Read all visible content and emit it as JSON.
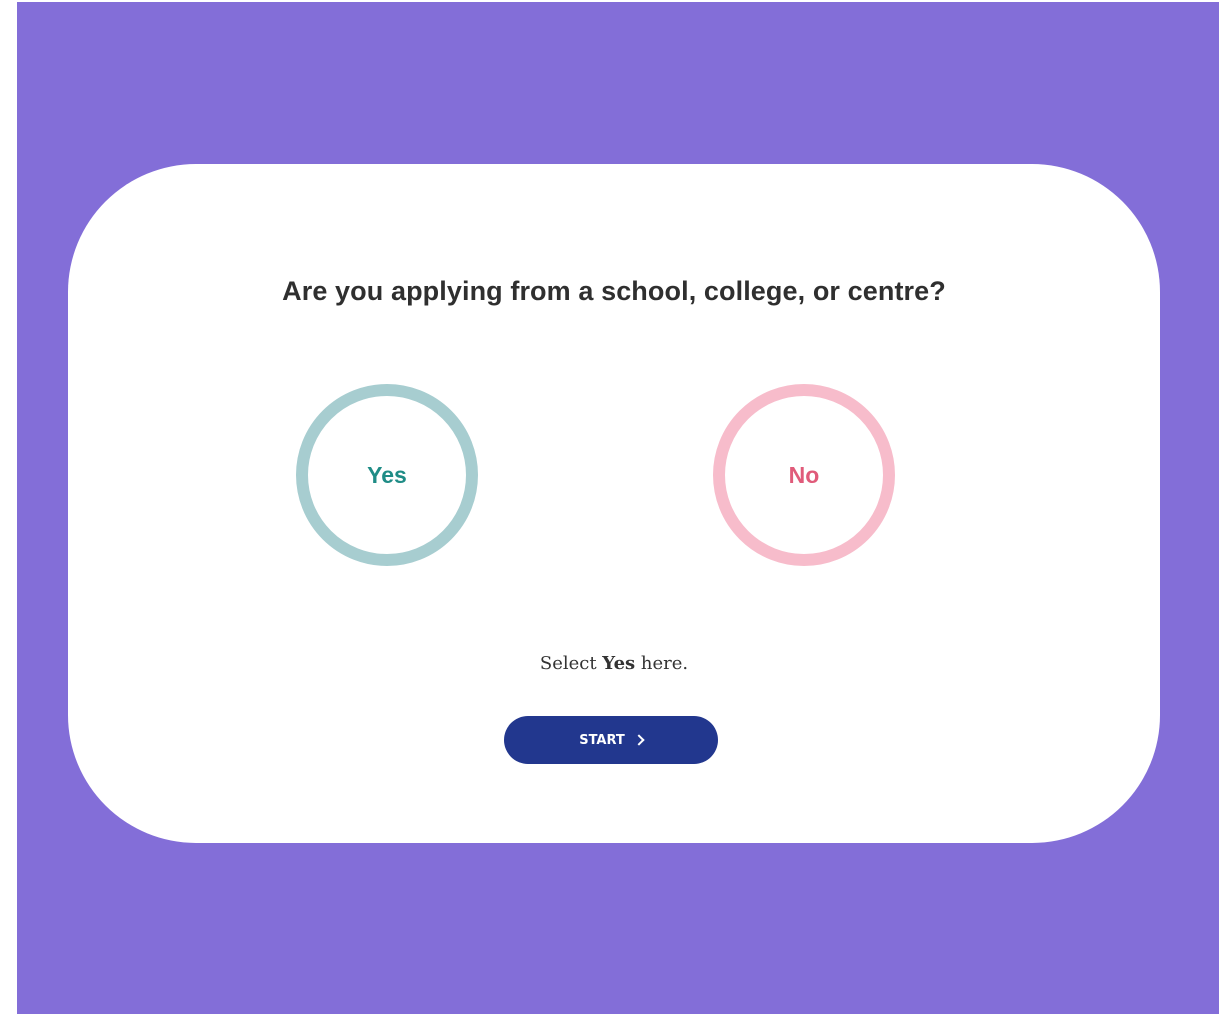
{
  "question": {
    "text": "Are you applying from a school, college, or centre?"
  },
  "choices": {
    "yes": {
      "label": "Yes",
      "ring_color": "#a7cdd0",
      "text_color": "#1f8c86"
    },
    "no": {
      "label": "No",
      "ring_color": "#f7bccb",
      "text_color": "#e05b7a"
    }
  },
  "hint": {
    "prefix": "Select ",
    "emphasis": "Yes",
    "suffix": " here."
  },
  "start_button": {
    "label": "START",
    "icon": "chevron-right-icon",
    "color": "#22378e"
  },
  "colors": {
    "background": "#836ed8",
    "card": "#ffffff"
  }
}
